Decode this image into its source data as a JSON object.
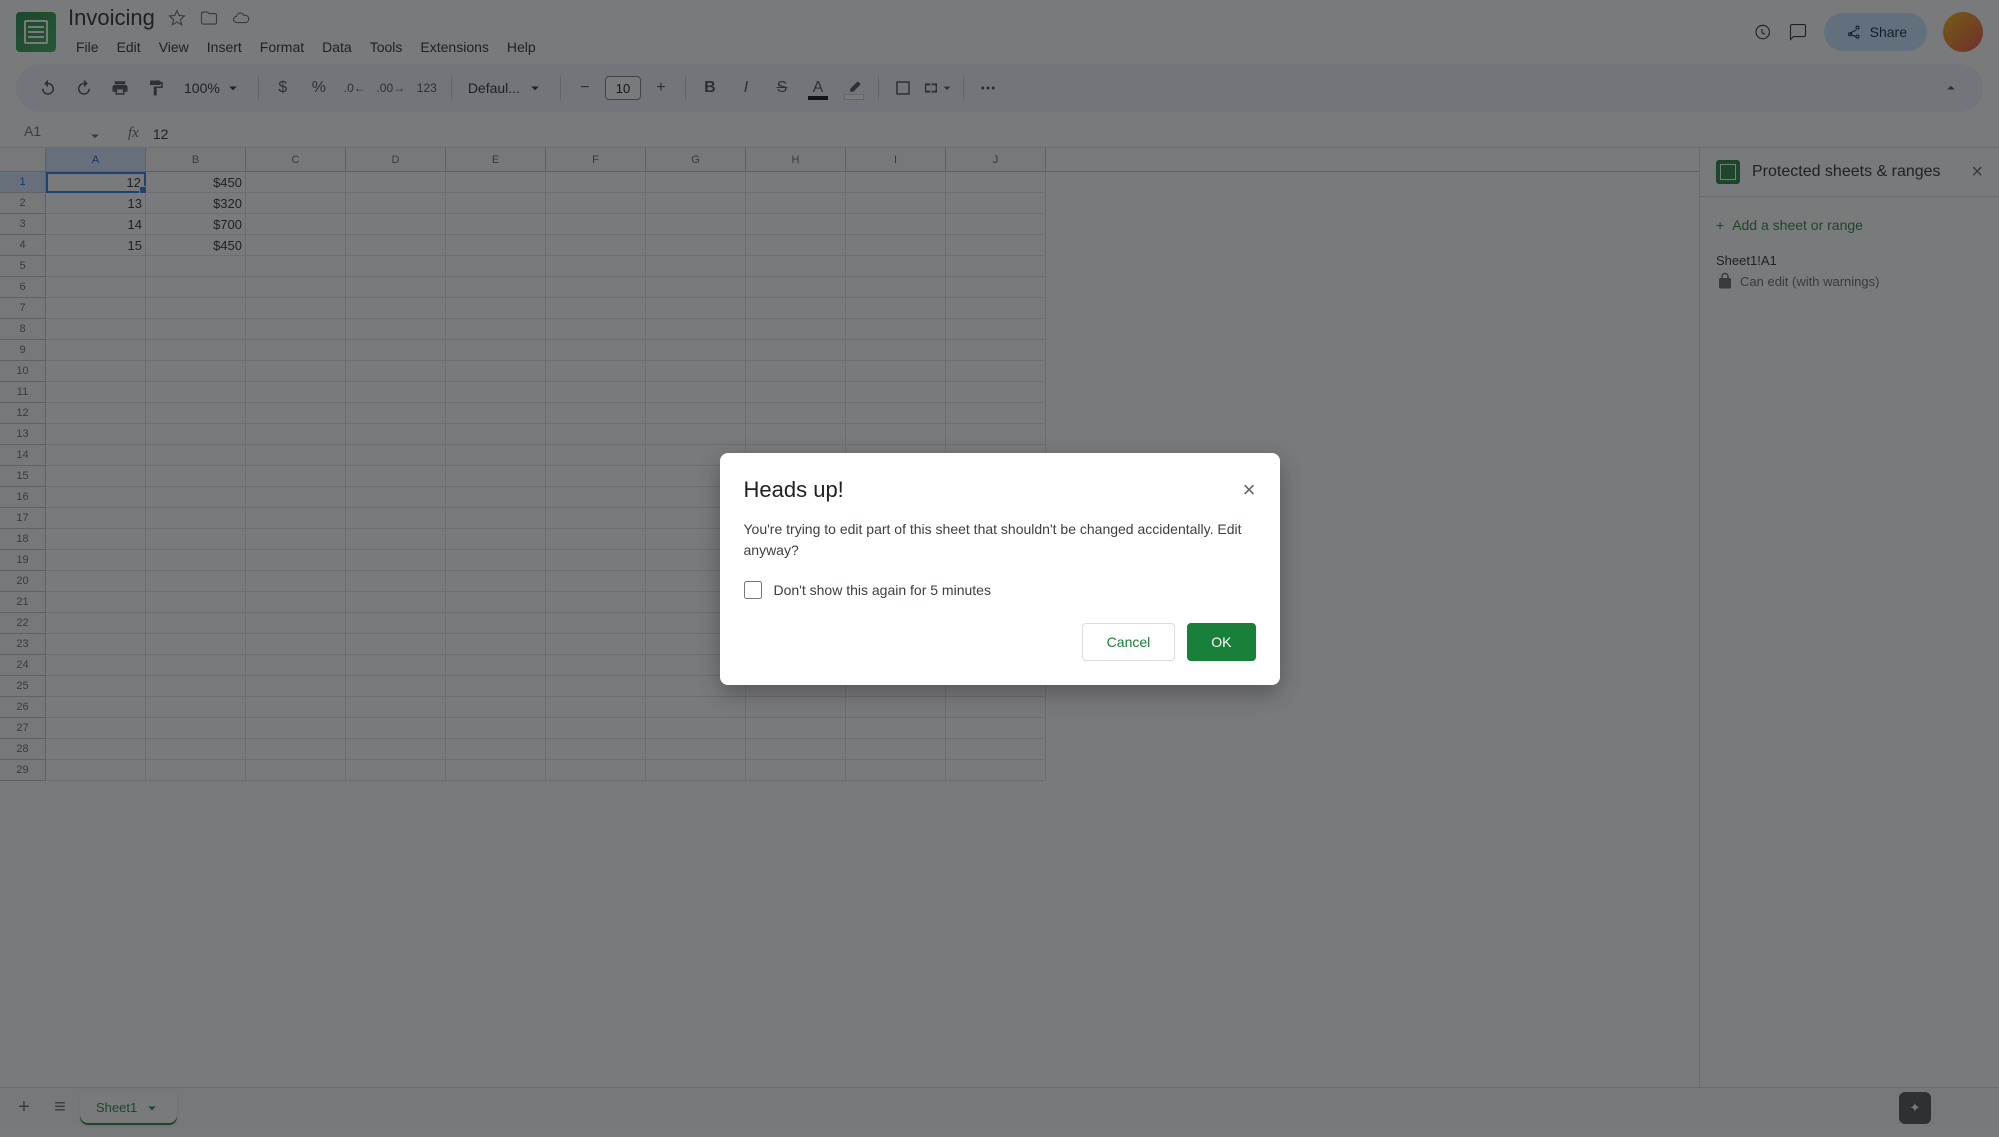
{
  "doc": {
    "title": "Invoicing"
  },
  "menubar": [
    "File",
    "Edit",
    "View",
    "Insert",
    "Format",
    "Data",
    "Tools",
    "Extensions",
    "Help"
  ],
  "share_label": "Share",
  "toolbar": {
    "zoom": "100%",
    "font": "Defaul...",
    "font_size": "10",
    "format_123": "123"
  },
  "name_box": "A1",
  "formula_value": "12",
  "columns": [
    "A",
    "B",
    "C",
    "D",
    "E",
    "F",
    "G",
    "H",
    "I",
    "J"
  ],
  "rows": [
    {
      "n": "1",
      "A": "12",
      "B": "$450"
    },
    {
      "n": "2",
      "A": "13",
      "B": "$320"
    },
    {
      "n": "3",
      "A": "14",
      "B": "$700"
    },
    {
      "n": "4",
      "A": "15",
      "B": "$450"
    }
  ],
  "row_count": 29,
  "side_panel": {
    "title": "Protected sheets & ranges",
    "add_label": "Add a sheet or range",
    "range_name": "Sheet1!A1",
    "range_desc": "Can edit (with warnings)"
  },
  "sheet_tab": "Sheet1",
  "dialog": {
    "title": "Heads up!",
    "body": "You're trying to edit part of this sheet that shouldn't be changed accidentally. Edit anyway?",
    "checkbox_label": "Don't show this again for 5 minutes",
    "cancel": "Cancel",
    "ok": "OK"
  }
}
